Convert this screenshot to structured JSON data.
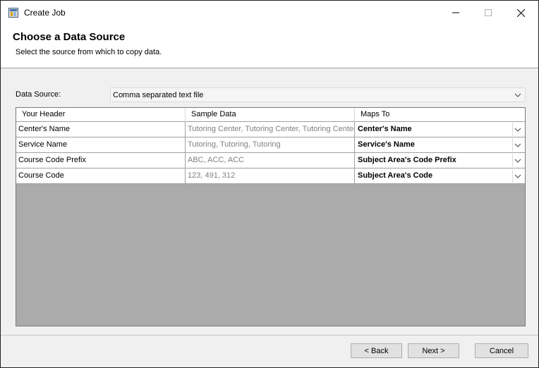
{
  "window": {
    "title": "Create Job",
    "icon": "app-window-icon"
  },
  "header": {
    "title": "Choose a Data Source",
    "subtitle": "Select the source from which to copy data."
  },
  "data_source": {
    "label": "Data Source:",
    "value": "Comma separated text file"
  },
  "grid": {
    "columns": [
      "Your Header",
      "Sample Data",
      "Maps To"
    ],
    "rows": [
      {
        "header": "Center's Name",
        "sample": "Tutoring Center, Tutoring Center, Tutoring Center",
        "maps_to": "Center's Name"
      },
      {
        "header": "Service Name",
        "sample": "Tutoring, Tutoring, Tutoring",
        "maps_to": "Service's Name"
      },
      {
        "header": "Course Code Prefix",
        "sample": "ABC, ACC, ACC",
        "maps_to": "Subject Area's Code Prefix"
      },
      {
        "header": "Course Code",
        "sample": "123, 491, 312",
        "maps_to": "Subject Area's Code"
      }
    ]
  },
  "buttons": {
    "back": "< Back",
    "next": "Next >",
    "cancel": "Cancel"
  },
  "colors": {
    "grid_empty_area": "#ababab",
    "sample_text": "#808080",
    "window_bg": "#f0f0f0"
  }
}
